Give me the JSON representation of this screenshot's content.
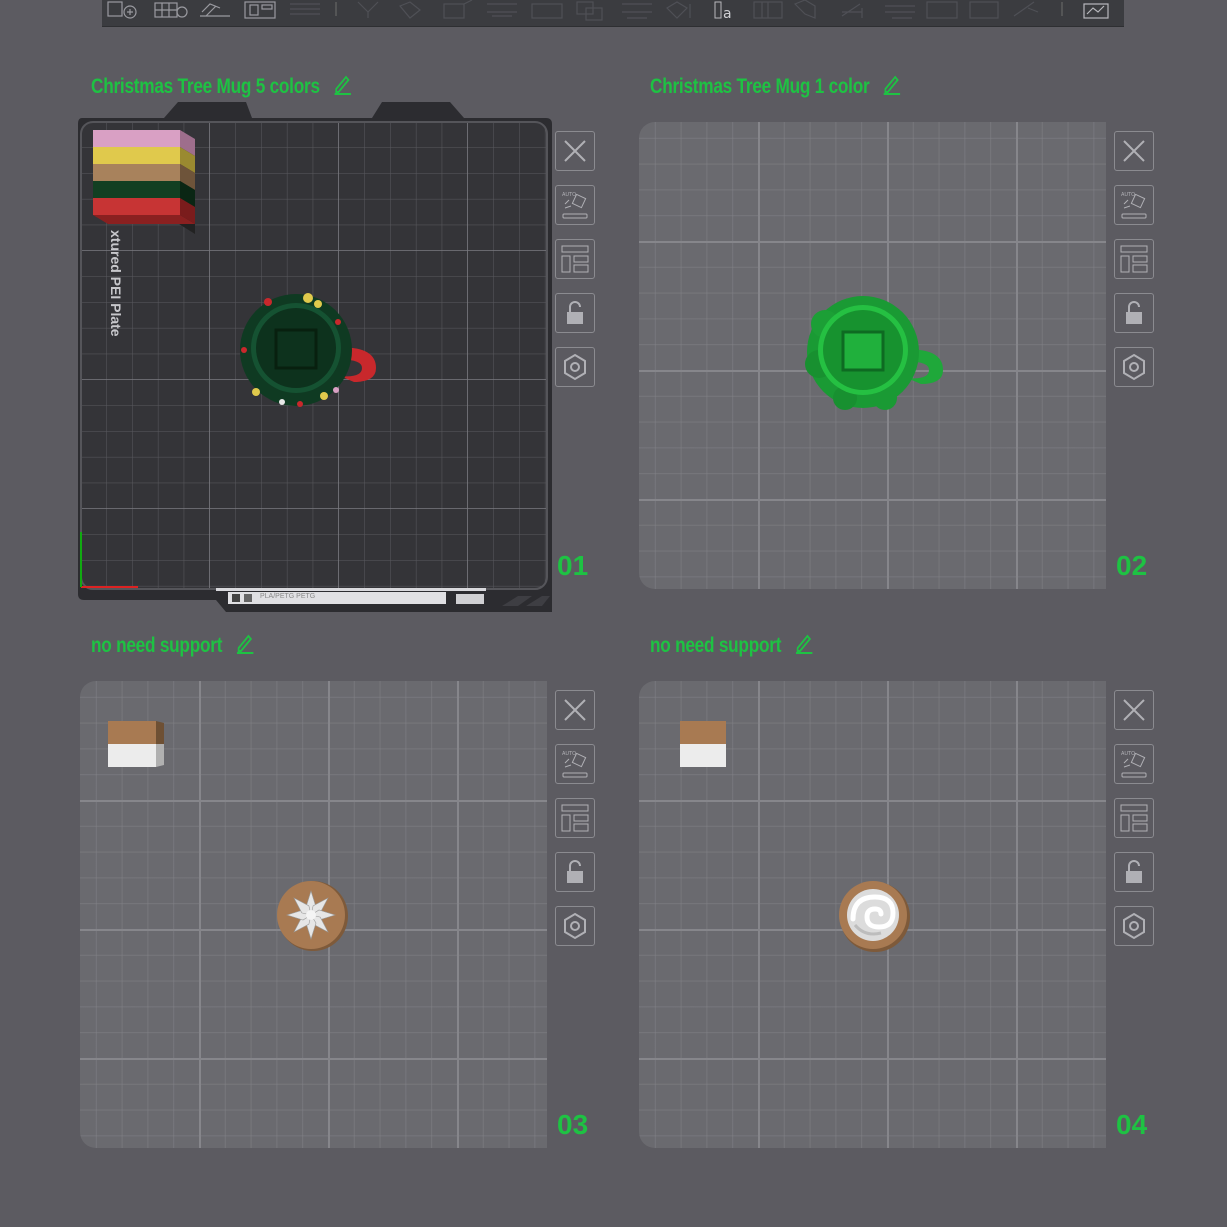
{
  "toolbar": {
    "icons": [
      "add-object-icon",
      "add-plate-icon",
      "auto-orient-icon",
      "arrange-icon",
      "layers-icon",
      "move-icon",
      "rotate-icon",
      "scale-icon",
      "cut-icon",
      "support-paint-icon",
      "seam-icon",
      "mesh-boolean-icon",
      "color-paint-icon",
      "text-icon",
      "measure-icon",
      "assembly-icon",
      "slice-view-icon"
    ]
  },
  "plates": [
    {
      "title": "Christmas Tree Mug 5 colors",
      "number": "01",
      "active": true,
      "plate_name": "xtured PEI Plate",
      "filament": "PLA/PETG PETG"
    },
    {
      "title": "Christmas Tree Mug 1 color",
      "number": "02",
      "active": false
    },
    {
      "title": "no need support",
      "number": "03",
      "active": false
    },
    {
      "title": "no need support",
      "number": "04",
      "active": false
    }
  ],
  "side_tools": [
    "close-icon",
    "auto-orient-icon",
    "arrange-icon",
    "lock-icon",
    "settings-icon"
  ],
  "colors": {
    "accent": "#1ec243",
    "mug_dark": "#0f3a22",
    "mug_green": "#1fa83a",
    "handle_red": "#c8282c",
    "cookie_brown": "#a87a52",
    "cream_white": "#e8e8e8",
    "swatch_pink": "#d9a0c4",
    "swatch_yellow": "#e0c94c",
    "swatch_tan": "#a8825c",
    "swatch_green": "#123f22",
    "swatch_red": "#c73434"
  }
}
